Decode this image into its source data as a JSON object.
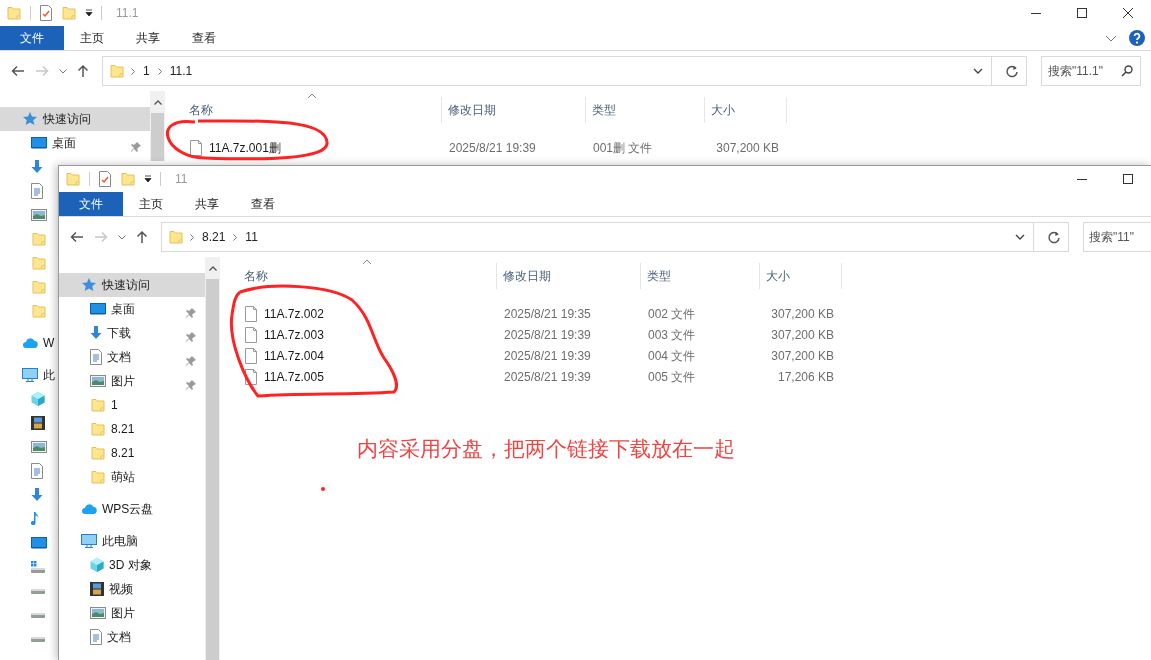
{
  "windows": [
    {
      "title": "11.1",
      "title_buttons": [
        {
          "kind": "minimize"
        },
        {
          "kind": "maximize"
        },
        {
          "kind": "close"
        }
      ],
      "ribbon_tabs": [
        {
          "label": "文件",
          "kind": "file"
        },
        {
          "label": "主页",
          "kind": "tab"
        },
        {
          "label": "共享",
          "kind": "tab"
        },
        {
          "label": "查看",
          "kind": "tab"
        }
      ],
      "ribbon_icons": [
        {
          "kind": "expand"
        },
        {
          "kind": "help"
        }
      ],
      "path": [
        "1",
        "11.1"
      ],
      "search": {
        "placeholder": "搜索\"11.1\"",
        "button": true
      },
      "sidebar": [
        {
          "kind": "star",
          "label": "快速访问",
          "selected": true,
          "children": [
            {
              "kind": "desktop",
              "label": "桌面",
              "selected": false,
              "pinned": true
            },
            {
              "kind": "download",
              "selected": false
            },
            {
              "kind": "doc",
              "selected": false
            },
            {
              "kind": "picture",
              "selected": false
            },
            {
              "kind": "folder",
              "selected": false
            },
            {
              "kind": "folder",
              "selected": false
            },
            {
              "kind": "folder",
              "selected": false
            },
            {
              "kind": "folder",
              "selected": false
            }
          ]
        },
        {
          "kind": "cloud",
          "label": "W",
          "selected": false
        },
        {
          "kind": "pc",
          "label": "此",
          "selected": false,
          "children": [
            {
              "kind": "cube",
              "selected": false
            },
            {
              "kind": "video",
              "selected": false
            },
            {
              "kind": "picture",
              "selected": false
            },
            {
              "kind": "doc",
              "selected": false
            },
            {
              "kind": "download",
              "selected": false
            },
            {
              "kind": "music",
              "selected": false
            },
            {
              "kind": "desktop",
              "selected": false
            },
            {
              "kind": "drivewin",
              "selected": false
            },
            {
              "kind": "drive",
              "selected": false
            },
            {
              "kind": "drive",
              "selected": false
            },
            {
              "kind": "drive",
              "selected": false
            }
          ]
        }
      ],
      "columns": [
        "名称",
        "修改日期",
        "类型",
        "大小"
      ],
      "files": [
        {
          "name": "11A.7z.001删",
          "date": "2025/8/21 19:39",
          "type": "001删 文件",
          "size": "307,200 KB"
        }
      ]
    },
    {
      "title": "11",
      "title_buttons": [
        {
          "kind": "minimize"
        },
        {
          "kind": "maximize"
        }
      ],
      "ribbon_tabs": [
        {
          "label": "文件",
          "kind": "file"
        },
        {
          "label": "主页",
          "kind": "tab"
        },
        {
          "label": "共享",
          "kind": "tab"
        },
        {
          "label": "查看",
          "kind": "tab"
        }
      ],
      "path": [
        "8.21",
        "11"
      ],
      "search": {
        "placeholder": "搜索\"11\""
      },
      "sidebar": [
        {
          "kind": "star",
          "label": "快速访问",
          "selected": true,
          "children": [
            {
              "kind": "desktop",
              "label": "桌面",
              "selected": false,
              "pinned": true
            },
            {
              "kind": "download",
              "label": "下载",
              "selected": false,
              "pinned": true
            },
            {
              "kind": "doc",
              "label": "文档",
              "selected": false,
              "pinned": true
            },
            {
              "kind": "picture",
              "label": "图片",
              "selected": false,
              "pinned": true
            },
            {
              "kind": "folder",
              "label": "1",
              "selected": false
            },
            {
              "kind": "folder",
              "label": "8.21",
              "selected": false
            },
            {
              "kind": "folder",
              "label": "8.21",
              "selected": false
            },
            {
              "kind": "folder",
              "label": "萌站",
              "selected": false
            }
          ]
        },
        {
          "kind": "cloud",
          "label": "WPS云盘",
          "selected": false
        },
        {
          "kind": "pc",
          "label": "此电脑",
          "selected": false,
          "children": [
            {
              "kind": "cube",
              "label": "3D 对象",
              "selected": false
            },
            {
              "kind": "video",
              "label": "视频",
              "selected": false
            },
            {
              "kind": "picture",
              "label": "图片",
              "selected": false
            },
            {
              "kind": "doc",
              "label": "文档",
              "selected": false
            }
          ]
        }
      ],
      "columns": [
        "名称",
        "修改日期",
        "类型",
        "大小"
      ],
      "files": [
        {
          "name": "11A.7z.002",
          "date": "2025/8/21 19:35",
          "type": "002 文件",
          "size": "307,200 KB"
        },
        {
          "name": "11A.7z.003",
          "date": "2025/8/21 19:39",
          "type": "003 文件",
          "size": "307,200 KB"
        },
        {
          "name": "11A.7z.004",
          "date": "2025/8/21 19:39",
          "type": "004 文件",
          "size": "307,200 KB"
        },
        {
          "name": "11A.7z.005",
          "date": "2025/8/21 19:39",
          "type": "005 文件",
          "size": "17,206 KB"
        }
      ]
    }
  ],
  "annotation": {
    "text": "内容采用分盘，把两个链接下载放在一起"
  }
}
